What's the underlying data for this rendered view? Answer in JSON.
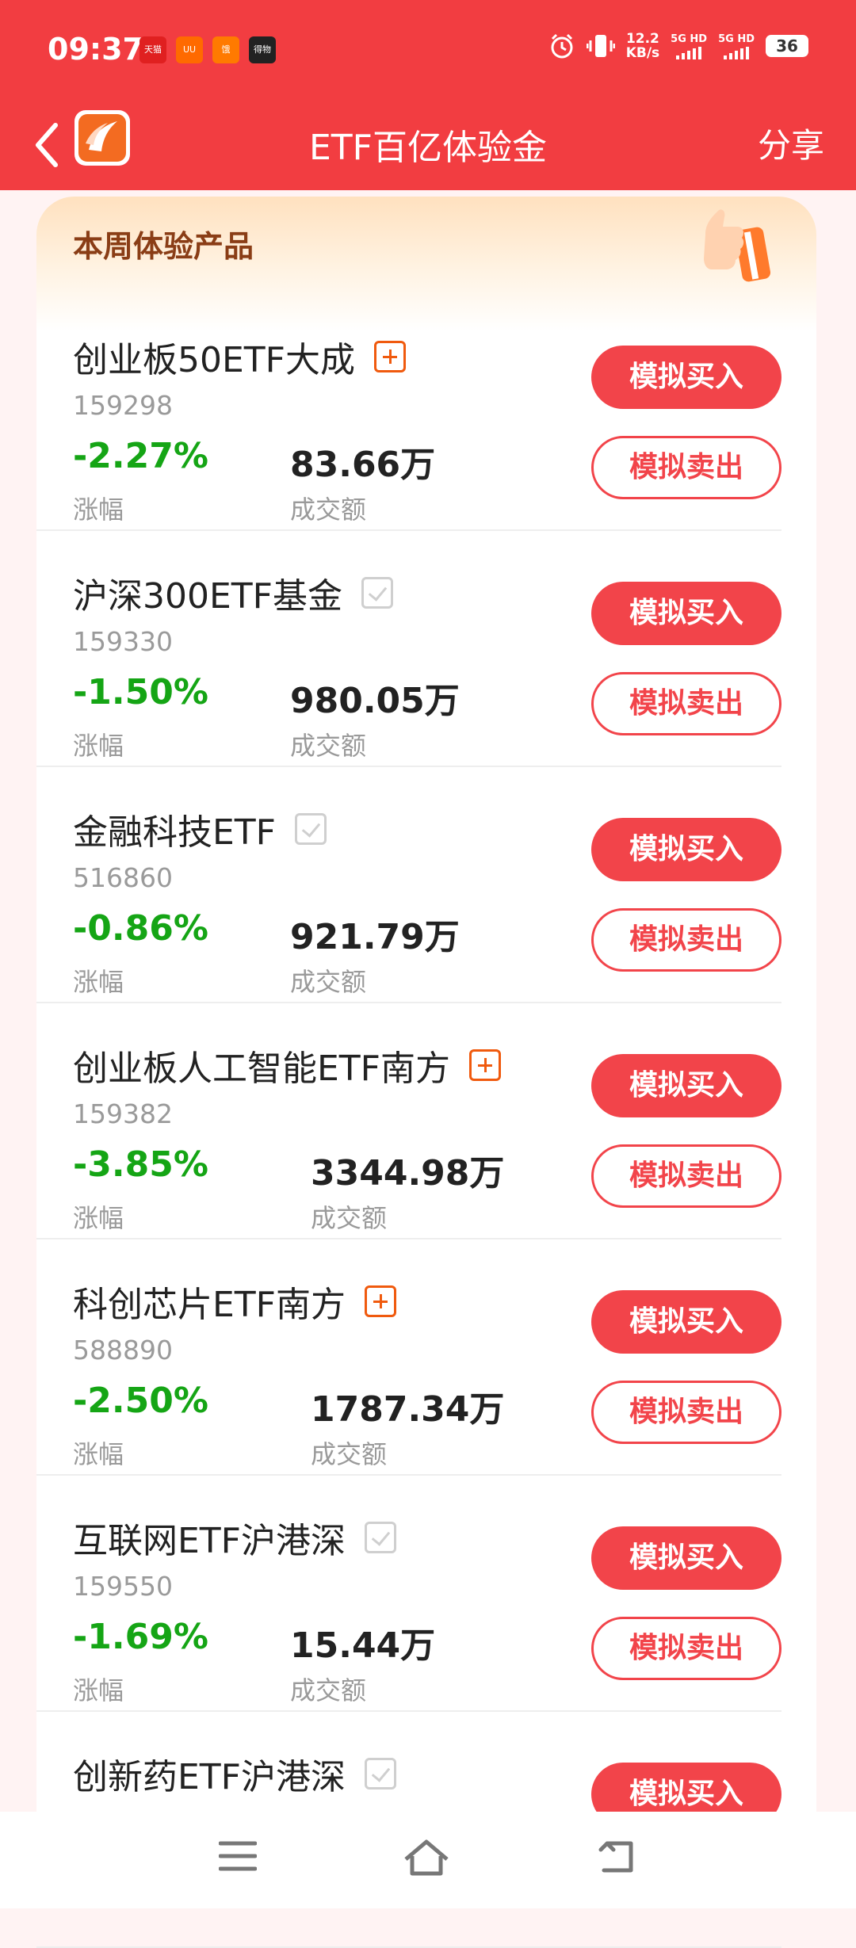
{
  "status_bar": {
    "time": "09:37",
    "app_icons": [
      "天猫",
      "UU",
      "饿",
      "得物"
    ],
    "net_speed_value": "12.2",
    "net_speed_unit": "KB/s",
    "signal1": "5G HD",
    "signal2": "5G HD",
    "battery": "36"
  },
  "navbar": {
    "title": "ETF百亿体验金",
    "share_label": "分享"
  },
  "panel": {
    "title": "本周体验产品"
  },
  "buttons": {
    "buy_label": "模拟买入",
    "sell_label": "模拟卖出"
  },
  "labels": {
    "change": "涨幅",
    "volume": "成交额"
  },
  "products": [
    {
      "name": "创业板50ETF大成",
      "code": "159298",
      "change": "-2.27%",
      "volume": "83.66万",
      "mark": "plus"
    },
    {
      "name": "沪深300ETF基金",
      "code": "159330",
      "change": "-1.50%",
      "volume": "980.05万",
      "mark": "check"
    },
    {
      "name": "金融科技ETF",
      "code": "516860",
      "change": "-0.86%",
      "volume": "921.79万",
      "mark": "check"
    },
    {
      "name": "创业板人工智能ETF南方",
      "code": "159382",
      "change": "-3.85%",
      "volume": "3344.98万",
      "mark": "plus"
    },
    {
      "name": "科创芯片ETF南方",
      "code": "588890",
      "change": "-2.50%",
      "volume": "1787.34万",
      "mark": "plus"
    },
    {
      "name": "互联网ETF沪港深",
      "code": "159550",
      "change": "-1.69%",
      "volume": "15.44万",
      "mark": "check"
    },
    {
      "name": "创新药ETF沪港深",
      "mark": "check"
    }
  ],
  "colors": {
    "header_red": "#f23d41",
    "button_red": "#f2444a",
    "down_green": "#15a515",
    "plus_orange": "#f05a0e"
  }
}
